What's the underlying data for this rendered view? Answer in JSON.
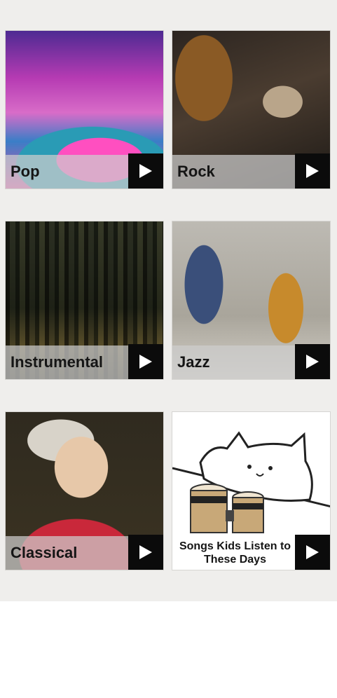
{
  "genres": [
    {
      "label": "Pop",
      "icon": "play-icon"
    },
    {
      "label": "Rock",
      "icon": "play-icon"
    },
    {
      "label": "Instrumental",
      "icon": "play-icon"
    },
    {
      "label": "Jazz",
      "icon": "play-icon"
    },
    {
      "label": "Classical",
      "icon": "play-icon"
    },
    {
      "label": "Songs Kids Listen to These Days",
      "icon": "play-icon"
    }
  ],
  "colors": {
    "panel_background": "#efeeec",
    "play_button": "#0b0b0b",
    "label_bar": "#cdcdcd"
  }
}
